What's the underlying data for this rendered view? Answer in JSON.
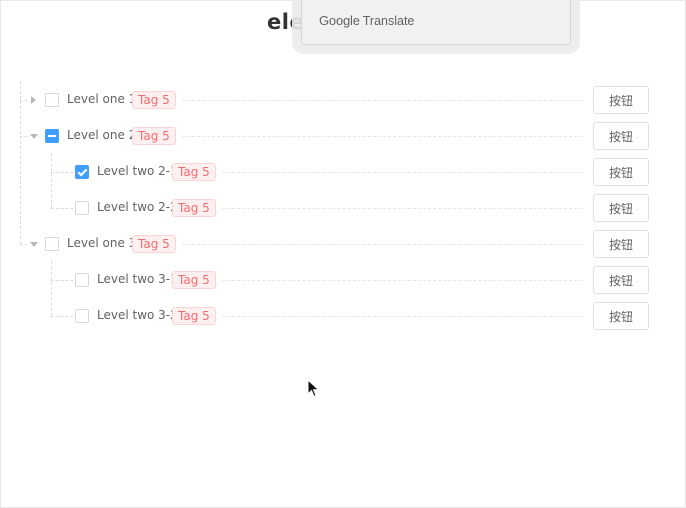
{
  "page": {
    "title": "ele"
  },
  "translate_popup": {
    "brand": "Google",
    "product": "Translate"
  },
  "tree": {
    "nodes": [
      {
        "label": "Level one 1",
        "tag": "Tag 5",
        "button": "按钮",
        "expanded": false,
        "check": "unchecked"
      },
      {
        "label": "Level one 2",
        "tag": "Tag 5",
        "button": "按钮",
        "expanded": true,
        "check": "indeterminate",
        "children": [
          {
            "label": "Level two 2-1",
            "tag": "Tag 5",
            "button": "按钮",
            "check": "checked"
          },
          {
            "label": "Level two 2-2",
            "tag": "Tag 5",
            "button": "按钮",
            "check": "unchecked"
          }
        ]
      },
      {
        "label": "Level one 3",
        "tag": "Tag 5",
        "button": "按钮",
        "expanded": true,
        "check": "unchecked",
        "children": [
          {
            "label": "Level two 3-1",
            "tag": "Tag 5",
            "button": "按钮",
            "check": "unchecked"
          },
          {
            "label": "Level two 3-2",
            "tag": "Tag 5",
            "button": "按钮",
            "check": "unchecked"
          }
        ]
      }
    ]
  },
  "colors": {
    "checkbox_active": "#409eff",
    "tag_text": "#f56c6c",
    "tag_bg": "#fef0f0"
  }
}
